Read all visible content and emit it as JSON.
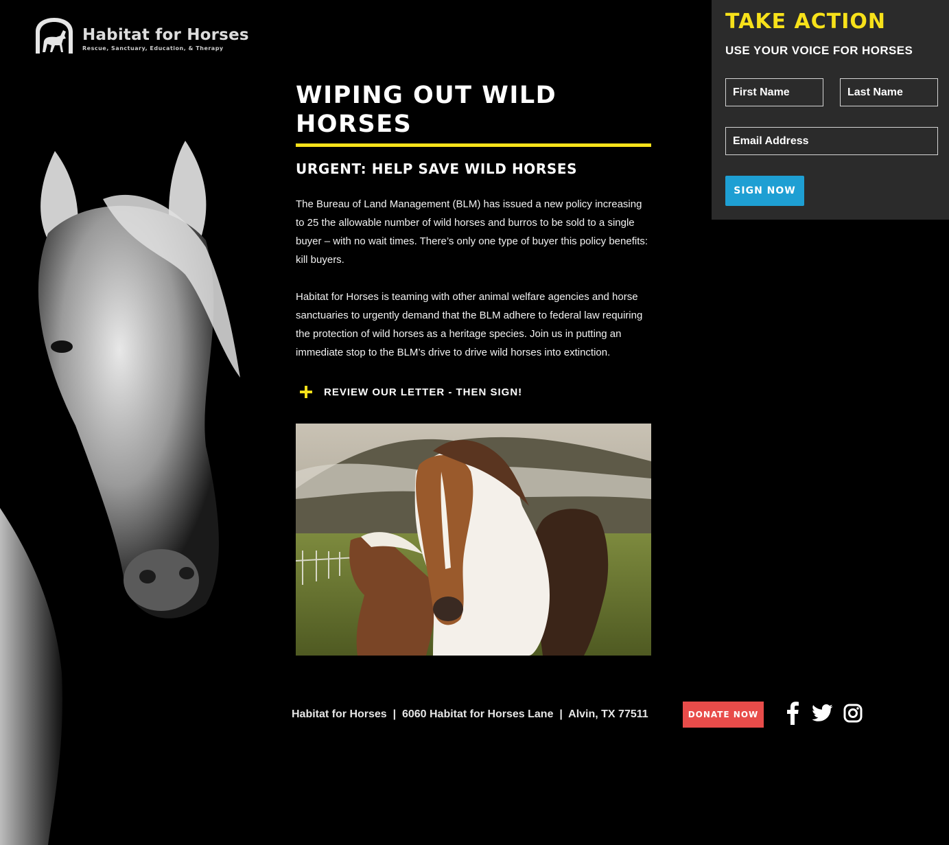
{
  "brand": {
    "name": "Habitat for Horses",
    "tagline": "Rescue, Sanctuary, Education, & Therapy",
    "logo_icon": "horse-arch-logo"
  },
  "main": {
    "title": "WIPING OUT WILD HORSES",
    "subtitle": "URGENT: HELP SAVE WILD HORSES",
    "paragraphs": [
      "The Bureau of Land Management (BLM) has issued a new policy increasing to 25 the allowable number of wild horses and burros to be sold to a single buyer – with no wait times. There’s only one type of buyer this policy benefits: kill buyers.",
      "Habitat for Horses is teaming with other animal welfare agencies and horse sanctuaries to urgently demand that the BLM adhere to federal law requiring the protection of wild horses as a heritage species. Join us in putting an immediate stop to the BLM’s drive to drive wild horses into extinction."
    ],
    "review_label": "REVIEW OUR LETTER - THEN SIGN!",
    "review_icon": "plus-icon"
  },
  "take_action": {
    "title": "TAKE ACTION",
    "subtitle": "USE YOUR VOICE FOR HORSES",
    "first_name_placeholder": "First Name",
    "last_name_placeholder": "Last Name",
    "email_placeholder": "Email Address",
    "submit_label": "SIGN NOW"
  },
  "footer": {
    "address": "Habitat for Horses  |  6060 Habitat for Horses Lane  |  Alvin, TX 77511",
    "donate_label": "DONATE NOW",
    "social_icons": [
      "facebook-icon",
      "twitter-icon",
      "instagram-icon"
    ]
  },
  "colors": {
    "accent_yellow": "#f7e11a",
    "panel_bg": "#2b2b2b",
    "sign_button": "#1e9fd3",
    "donate_button": "#e84c4a",
    "background": "#000000"
  }
}
